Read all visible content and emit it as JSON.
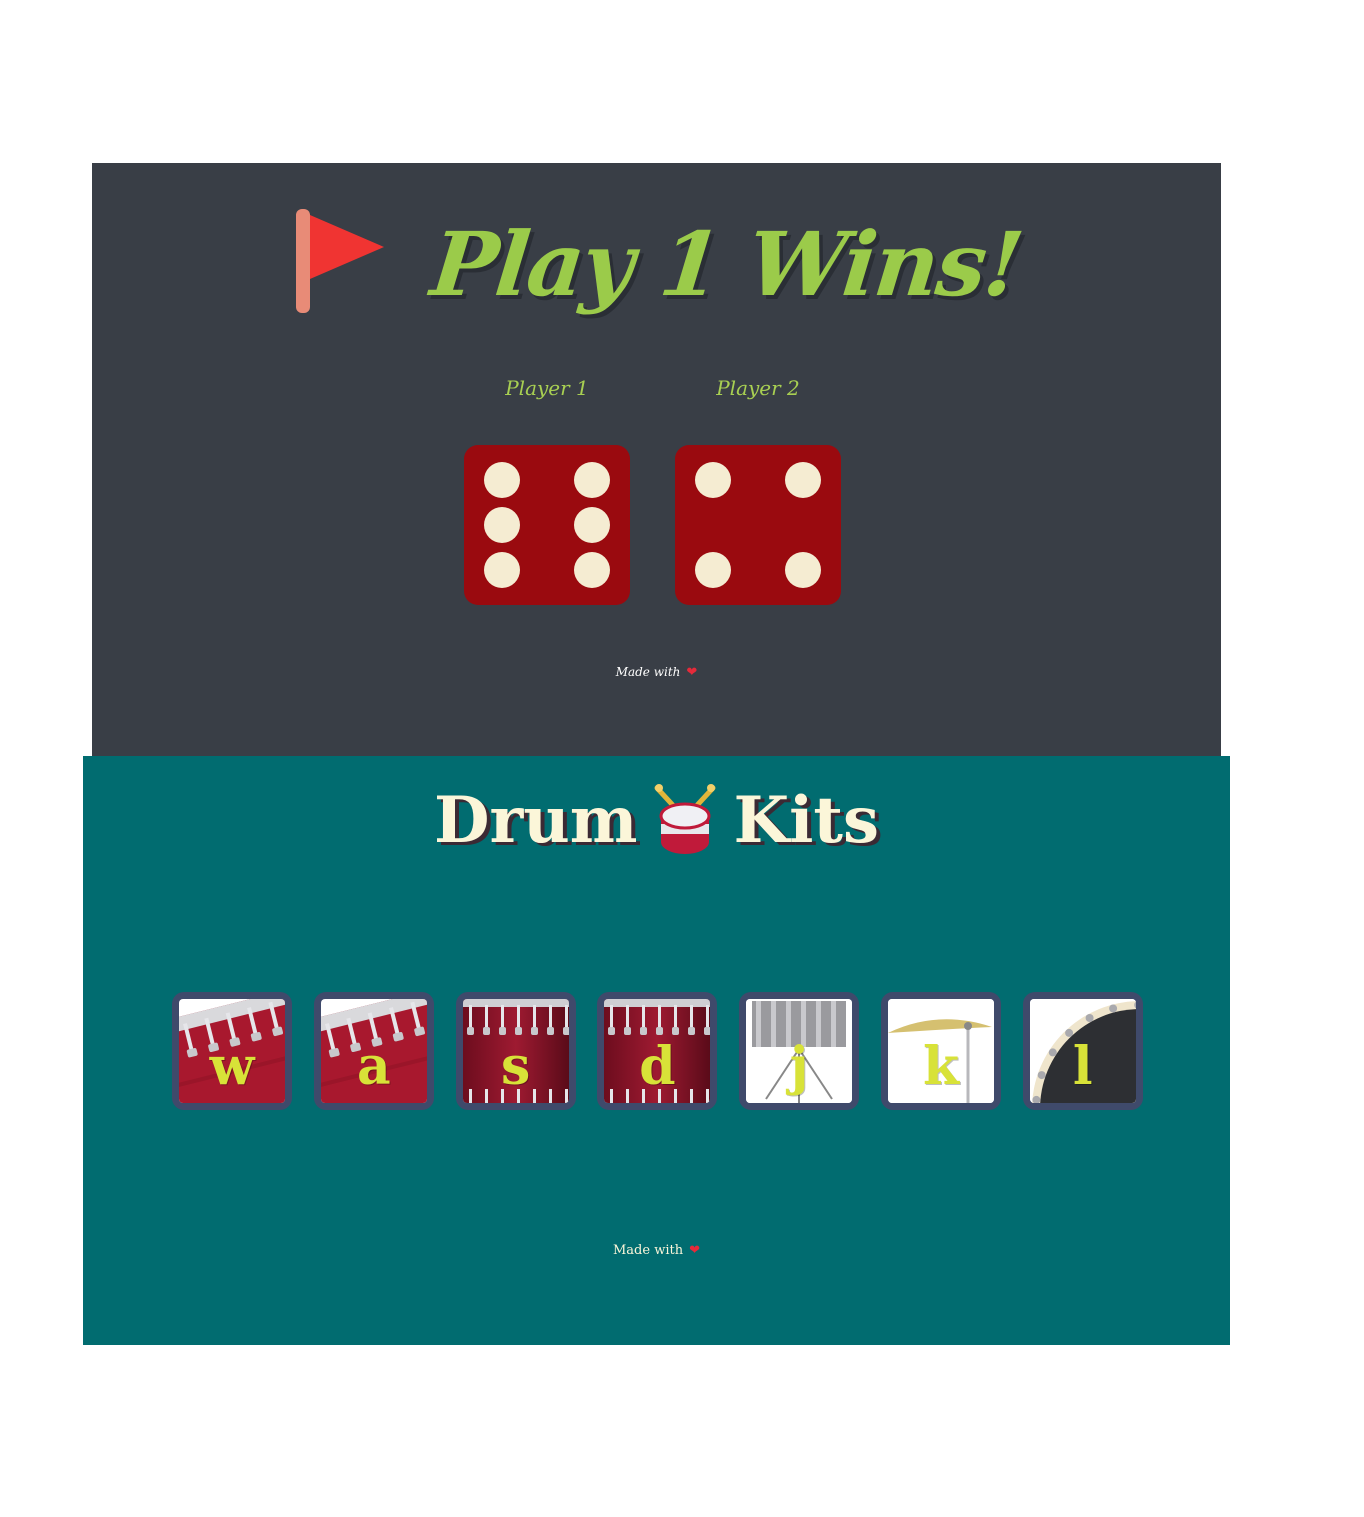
{
  "dice_game": {
    "title": "Play 1 Wins!",
    "title_icon": "red-flag-icon",
    "players": [
      {
        "label": "Player 1",
        "die_value": 6
      },
      {
        "label": "Player 2",
        "die_value": 4
      }
    ],
    "footer": {
      "text": "Made with",
      "icon": "heart-icon",
      "heart": "❤"
    }
  },
  "drum_kit": {
    "title_left": "Drum",
    "title_icon": "drum-icon",
    "title_right": "Kits",
    "keys": [
      {
        "letter": "w",
        "instrument": "tom-1"
      },
      {
        "letter": "a",
        "instrument": "tom-2"
      },
      {
        "letter": "s",
        "instrument": "tom-3"
      },
      {
        "letter": "d",
        "instrument": "tom-4"
      },
      {
        "letter": "j",
        "instrument": "snare"
      },
      {
        "letter": "k",
        "instrument": "crash"
      },
      {
        "letter": "l",
        "instrument": "kick"
      }
    ],
    "footer": {
      "text": "Made with",
      "icon": "heart-icon",
      "heart": "❤"
    }
  },
  "colors": {
    "dice_bg": "#393e46",
    "dice_title": "#9bcb4a",
    "die_face": "#9a0a0f",
    "pip": "#f5ecd2",
    "drum_bg": "#016c70",
    "drum_title": "#fbf6d9",
    "key_frame": "#3f4a6b",
    "key_letter": "#d8e238"
  }
}
